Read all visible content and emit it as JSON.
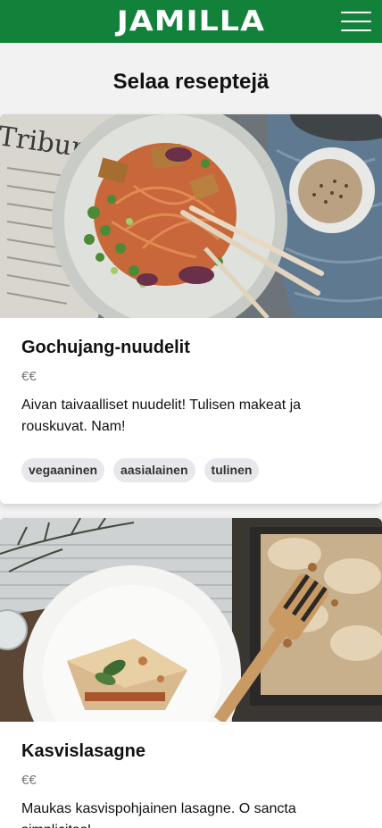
{
  "header": {
    "brand": "JAMILLA",
    "menu_icon": "hamburger-menu-icon",
    "background_color": "#12823a"
  },
  "page": {
    "title": "Selaa reseptejä"
  },
  "recipes": [
    {
      "title": "Gochujang-nuudelit",
      "price": "€€",
      "description": "Aivan taivaalliset nuudelit! Tulisen makeat ja rouskuvat. Nam!",
      "tags": [
        "vegaaninen",
        "aasialainen",
        "tulinen"
      ]
    },
    {
      "title": "Kasvislasagne",
      "price": "€€",
      "description": "Maukas kasvispohjainen lasagne. O sancta simplicitas!"
    }
  ]
}
